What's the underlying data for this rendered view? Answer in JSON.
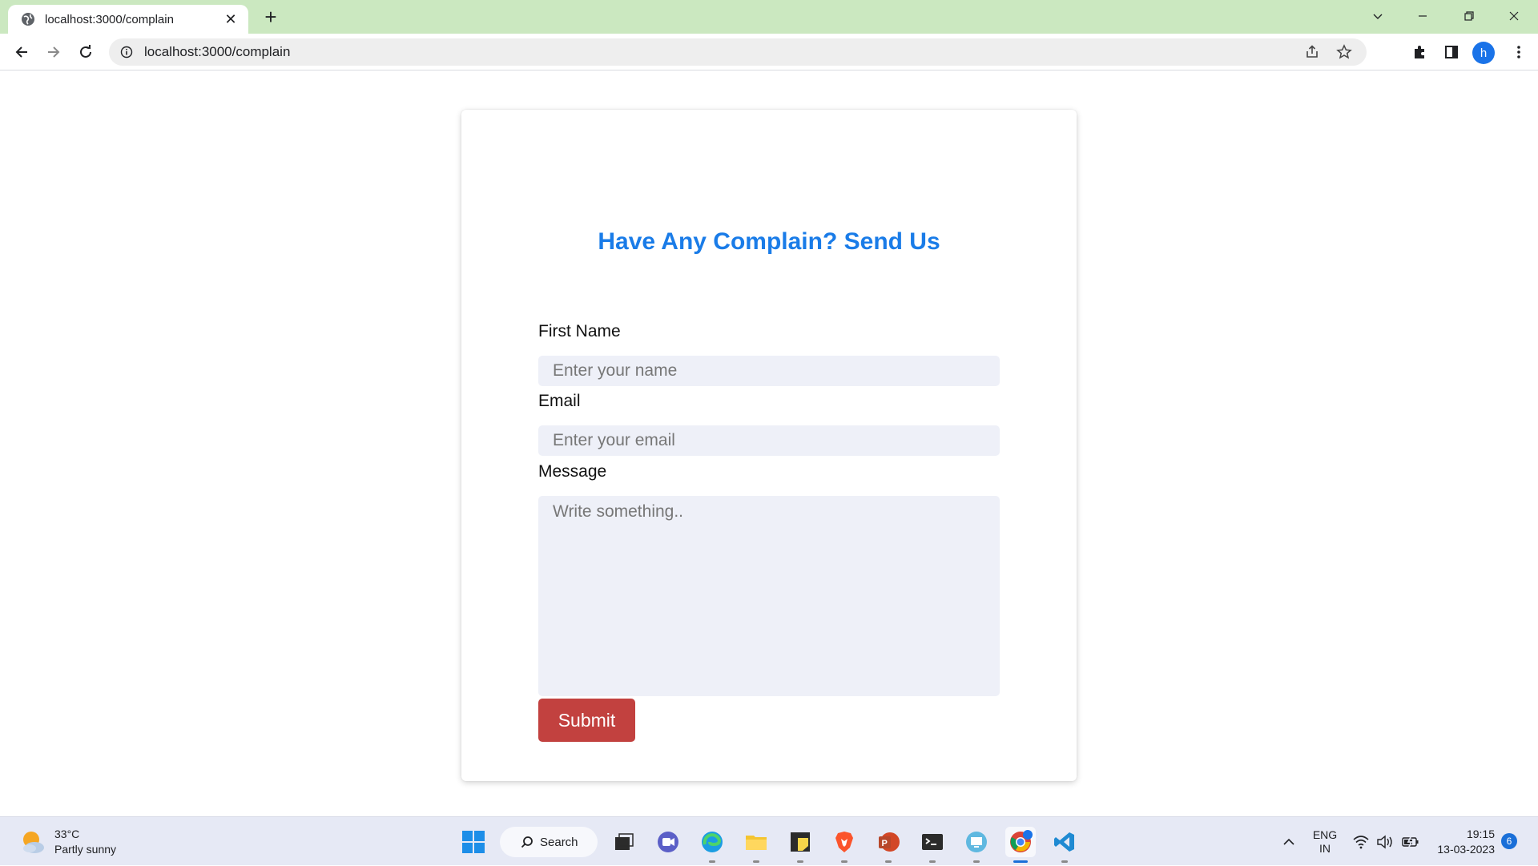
{
  "browser": {
    "tab_title": "localhost:3000/complain",
    "url": "localhost:3000/complain",
    "profile_initial": "h"
  },
  "form": {
    "title": "Have Any Complain? Send Us",
    "first_name_label": "First Name",
    "first_name_placeholder": "Enter your name",
    "email_label": "Email",
    "email_placeholder": "Enter your email",
    "message_label": "Message",
    "message_placeholder": "Write something..",
    "submit_label": "Submit"
  },
  "taskbar": {
    "weather_temp": "33°C",
    "weather_desc": "Partly sunny",
    "search_label": "Search",
    "apps": [
      "start-icon",
      "task-view-icon",
      "teams-chat-icon",
      "edge-icon",
      "file-explorer-icon",
      "sticky-notes-icon",
      "brave-icon",
      "powerpoint-icon",
      "terminal-icon",
      "remote-desktop-icon",
      "chrome-icon",
      "vscode-icon"
    ],
    "lang_line1": "ENG",
    "lang_line2": "IN",
    "time": "19:15",
    "date": "13-03-2023",
    "notification_count": "6"
  },
  "colors": {
    "title_blue": "#1a7ce8",
    "submit_red": "#c2413f",
    "field_bg": "#eef0f8",
    "tabstrip_green": "#cbe8c0"
  }
}
